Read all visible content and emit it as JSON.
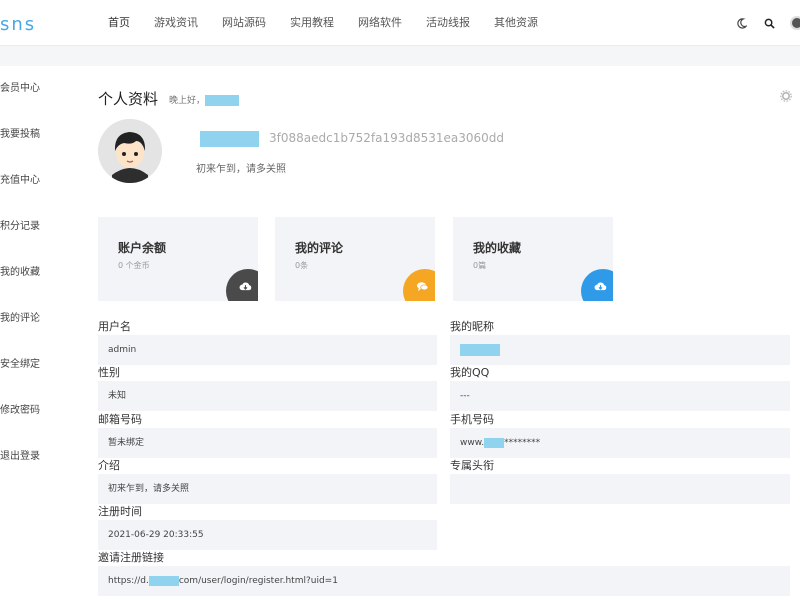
{
  "brand": "sns",
  "nav": [
    "首页",
    "游戏资讯",
    "网站源码",
    "实用教程",
    "网络软件",
    "活动线报",
    "其他资源"
  ],
  "icons": {
    "theme": "moon-icon",
    "search": "search-icon",
    "user": "avatar",
    "settings": "gear-icon"
  },
  "sidebar": [
    "会员中心",
    "我要投稿",
    "充值中心",
    "积分记录",
    "我的收藏",
    "我的评论",
    "安全绑定",
    "修改密码",
    "退出登录"
  ],
  "profile": {
    "title": "个人资料",
    "greeting": "晚上好，",
    "hash": "3f088aedc1b752fa193d8531ea3060dd",
    "bio": "初来乍到，请多关照"
  },
  "stats": [
    {
      "title": "账户余额",
      "sub": "0 个金币",
      "icon": "download-cloud-icon",
      "color": "#4a4a4a"
    },
    {
      "title": "我的评论",
      "sub": "0条",
      "icon": "chat-bubble-icon",
      "color": "#f5a623"
    },
    {
      "title": "我的收藏",
      "sub": "0篇",
      "icon": "download-cloud-icon",
      "color": "#2f9be8"
    }
  ],
  "fields": {
    "username": {
      "label": "用户名",
      "value": "admin"
    },
    "nickname": {
      "label": "我的昵称",
      "value": ""
    },
    "gender": {
      "label": "性别",
      "value": "未知"
    },
    "qq": {
      "label": "我的QQ",
      "value": "---"
    },
    "email": {
      "label": "邮箱号码",
      "value": "暂未绑定"
    },
    "phone": {
      "label": "手机号码",
      "value_prefix": "www.",
      "value_suffix": "********"
    },
    "intro": {
      "label": "介绍",
      "value": "初来乍到，请多关照"
    },
    "header": {
      "label": "专属头衔",
      "value": ""
    },
    "regtime": {
      "label": "注册时间",
      "value": "2021-06-29 20:33:55"
    },
    "invite": {
      "label": "邀请注册链接",
      "value_prefix": "https://d.",
      "value_suffix": "com/user/login/register.html?uid=1"
    }
  }
}
